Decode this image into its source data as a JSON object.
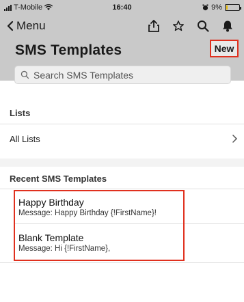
{
  "status_bar": {
    "carrier": "T-Mobile",
    "time": "16:40",
    "battery_percent": "9%",
    "battery_fraction": 0.09,
    "icons": [
      "signal-icon",
      "wifi-icon",
      "battery-icon"
    ]
  },
  "nav": {
    "back_label": "Menu",
    "icons": [
      "share-icon",
      "star-icon",
      "search-icon",
      "bell-icon"
    ]
  },
  "header": {
    "title": "SMS Templates",
    "new_label": "New"
  },
  "search": {
    "placeholder": "Search SMS Templates"
  },
  "lists_section": {
    "label": "Lists",
    "items": [
      {
        "label": "All Lists"
      }
    ]
  },
  "recent_section": {
    "label": "Recent SMS Templates",
    "items": [
      {
        "title": "Happy Birthday",
        "message": "Message: Happy Birthday {!FirstName}!"
      },
      {
        "title": "Blank Template",
        "message": "Message: Hi {!FirstName},"
      }
    ]
  },
  "colors": {
    "header_bg": "#c9c9c9",
    "highlight": "#e0301e"
  }
}
